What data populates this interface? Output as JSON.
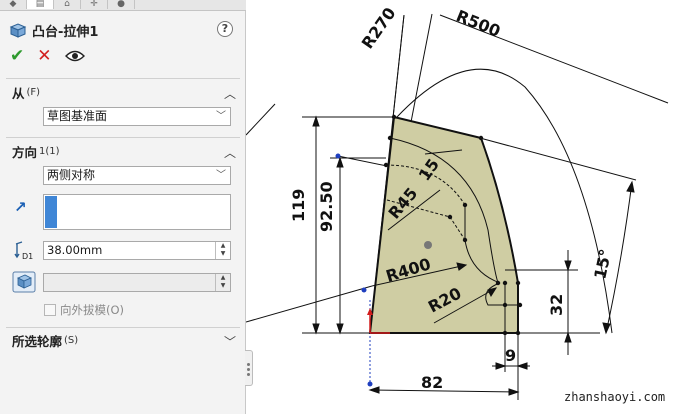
{
  "panel": {
    "title": "凸台-拉伸1",
    "help": "?",
    "ok": "✔",
    "cancel": "✕",
    "preview": "👁",
    "from": {
      "label": "从",
      "code": "(F)",
      "value": "草图基准面"
    },
    "direction": {
      "label": "方向",
      "code": "1(1)",
      "type": "两侧对称",
      "depth": "38.00mm",
      "draft_label": "向外拔模(O)"
    },
    "contours": {
      "label": "所选轮廓",
      "code": "(S)"
    }
  },
  "sketch": {
    "dims": {
      "r270": "R270",
      "r500": "R500",
      "d119": "119",
      "d9250": "92.50",
      "d15": "15",
      "r45": "R45",
      "r400": "R400",
      "r20": "R20",
      "d32": "32",
      "a15": "15°",
      "d9": "9",
      "d82": "82"
    },
    "fill_color": "#cfcda3"
  },
  "watermark": "zhanshaoyi.com"
}
